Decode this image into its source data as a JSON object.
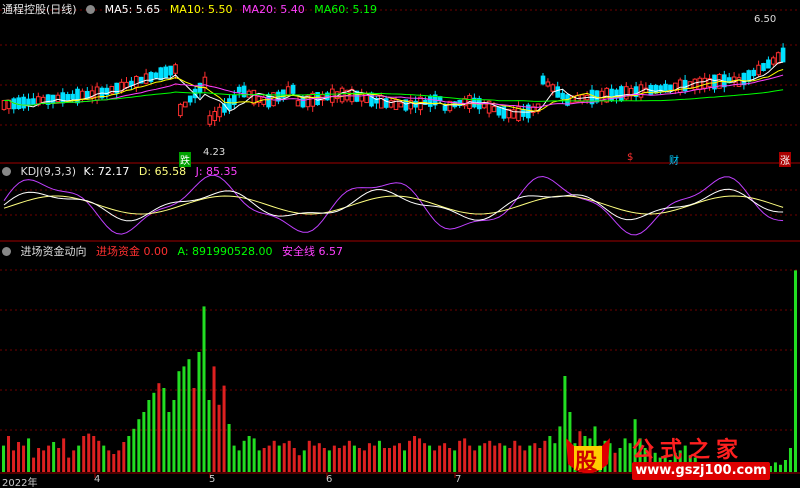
{
  "main_panel": {
    "title": "通程控股(日线)",
    "ma5": "MA5: 5.65",
    "ma10": "MA10: 5.50",
    "ma20": "MA20: 5.40",
    "ma60": "MA60: 5.19",
    "high_label": "6.50",
    "low_label": "4.23",
    "markers": {
      "drop": "跌",
      "fin": "财",
      "dollar": "$",
      "rise": "涨"
    }
  },
  "kdj_panel": {
    "title": "KDJ(9,3,3)",
    "k": "K: 72.17",
    "d": "D: 65.58",
    "j": "J: 85.35"
  },
  "fund_panel": {
    "title": "进场资金动向",
    "entry": "进场资金  0.00",
    "a": "A: 891990528.00",
    "safe": "安全线  6.57"
  },
  "x_axis": {
    "year": "2022年",
    "m4": "4",
    "m5": "5",
    "m6": "6",
    "m7": "7"
  },
  "watermark": {
    "logo_char": "股",
    "name": "公式之家",
    "url": "www.gszj100.com"
  },
  "colors": {
    "up": "#ff3030",
    "down": "#00e0ff",
    "ma5": "#ffffff",
    "ma10": "#ffff00",
    "ma20": "#ff40ff",
    "ma60": "#00ff00",
    "bar_green": "#22dd22",
    "bar_red": "#dd2020"
  },
  "chart_data": [
    {
      "type": "candlestick",
      "title": "通程控股(日线)",
      "series": [
        {
          "name": "MA5",
          "last": 5.65
        },
        {
          "name": "MA10",
          "last": 5.5
        },
        {
          "name": "MA20",
          "last": 5.4
        },
        {
          "name": "MA60",
          "last": 5.19
        }
      ],
      "annotations": [
        "6.50",
        "4.23"
      ]
    },
    {
      "type": "line",
      "title": "KDJ(9,3,3)",
      "series": [
        {
          "name": "K",
          "last": 72.17
        },
        {
          "name": "D",
          "last": 65.58
        },
        {
          "name": "J",
          "last": 85.35
        }
      ]
    },
    {
      "type": "bar",
      "title": "进场资金动向",
      "series": [
        {
          "name": "进场资金",
          "last": 0.0
        },
        {
          "name": "A",
          "last": 891990528.0
        },
        {
          "name": "安全线",
          "last": 6.57
        }
      ],
      "values": [
        22,
        30,
        18,
        25,
        22,
        28,
        12,
        20,
        18,
        22,
        25,
        20,
        28,
        12,
        18,
        22,
        30,
        32,
        30,
        26,
        22,
        18,
        15,
        18,
        25,
        30,
        36,
        44,
        50,
        60,
        66,
        74,
        70,
        50,
        60,
        84,
        88,
        94,
        70,
        100,
        138,
        60,
        88,
        56,
        72,
        40,
        22,
        18,
        26,
        30,
        28,
        18,
        20,
        22,
        26,
        22,
        24,
        26,
        20,
        14,
        18,
        26,
        22,
        24,
        20,
        18,
        22,
        20,
        22,
        26,
        22,
        20,
        18,
        24,
        22,
        26,
        20,
        20,
        22,
        24,
        18,
        26,
        30,
        28,
        24,
        22,
        18,
        22,
        24,
        20,
        18,
        26,
        28,
        22,
        18,
        22,
        24,
        26,
        22,
        24,
        22,
        20,
        26,
        22,
        18,
        22,
        24,
        20,
        26,
        30,
        24,
        38,
        80,
        50,
        24,
        34,
        30,
        28,
        38,
        22,
        26,
        24,
        16,
        20,
        28,
        24,
        44,
        28,
        20,
        22,
        16,
        12,
        14,
        10,
        16,
        18,
        22,
        14,
        12,
        8,
        6,
        5,
        6,
        4,
        6,
        8,
        6,
        5,
        4,
        7,
        6,
        4,
        6,
        5,
        8,
        6,
        10,
        20,
        168
      ]
    }
  ]
}
